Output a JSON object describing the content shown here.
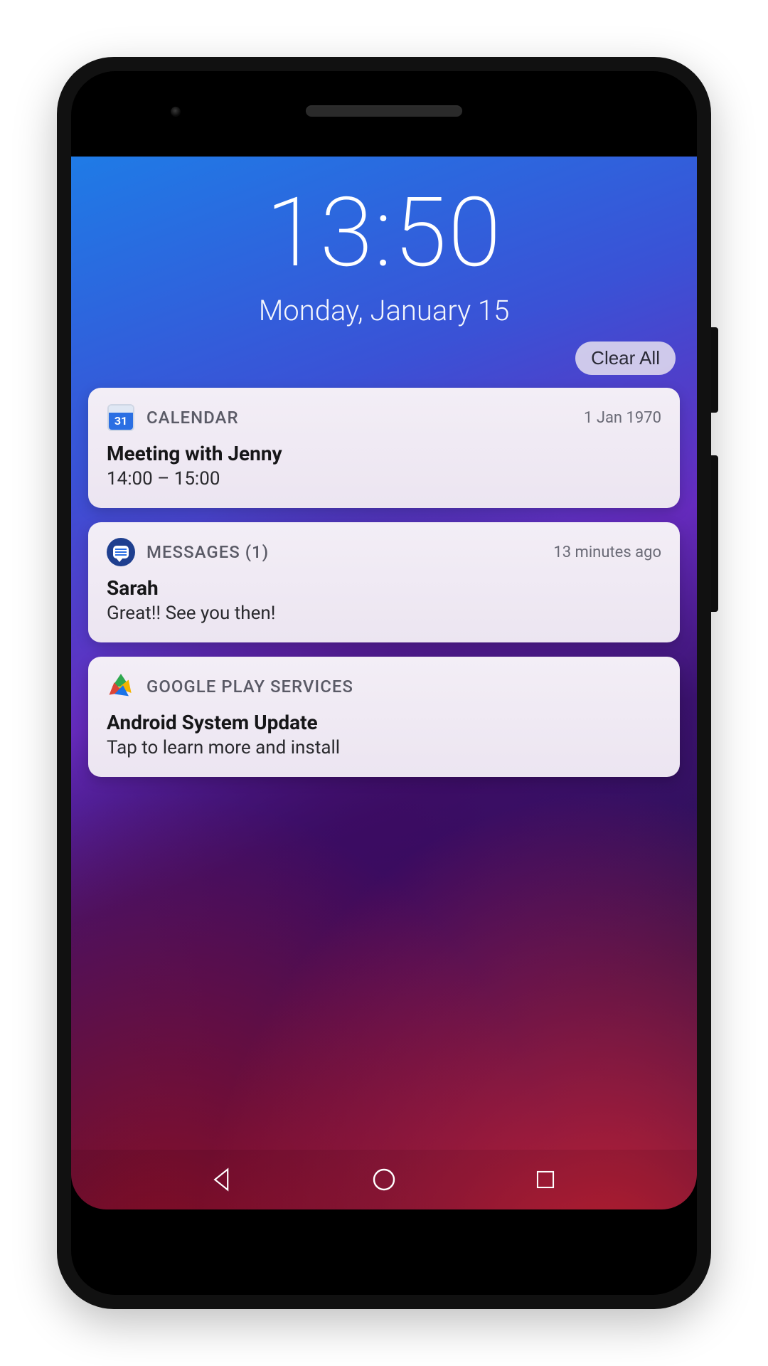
{
  "lockscreen": {
    "time": "13:50",
    "date": "Monday, January 15",
    "clear_all_label": "Clear All"
  },
  "notifications": [
    {
      "icon": "calendar-icon",
      "icon_day": "31",
      "app": "CALENDAR",
      "timestamp": "1 Jan 1970",
      "title": "Meeting with Jenny",
      "body": "14:00 – 15:00"
    },
    {
      "icon": "messages-icon",
      "app": "MESSAGES (1)",
      "timestamp": "13 minutes ago",
      "title": "Sarah",
      "body": "Great!! See you then!"
    },
    {
      "icon": "play-services-icon",
      "app": "GOOGLE PLAY SERVICES",
      "timestamp": "",
      "title": "Android System Update",
      "body": "Tap to learn more and install"
    }
  ]
}
